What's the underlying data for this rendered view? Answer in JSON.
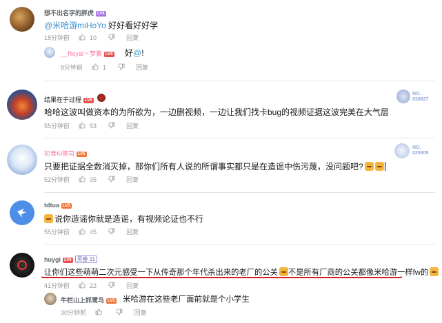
{
  "comments": [
    {
      "username": "想不出名字的胖虎",
      "level": "LV6",
      "content_mention": "@米哈游miHoYo",
      "content_text": "好好看好好学",
      "time": "18分钟前",
      "likes": "10",
      "reply_label": "回复",
      "replies": [
        {
          "username": "__Royal丶梦紫",
          "level": "LV6",
          "content_text": "好",
          "content_mention": "@",
          "content_tail": "!",
          "time": "8分钟前",
          "likes": "1",
          "reply_label": "回复"
        }
      ]
    },
    {
      "username": "结果在于过程",
      "level": "LV6",
      "content_text": "哈哈这波叫做资本的为所欲为，一边删视频，一边让我们找卡bug的视频证据这波完美在大气层",
      "time": "55分钟前",
      "likes": "53",
      "reply_label": "回复",
      "no_label": "NO.",
      "no_value": "030627"
    },
    {
      "username": "初音Ki德司",
      "level": "LV5",
      "content_text": "只要把证据全数消灭掉，那你们所有人说的所谓事实都只是在造谣中伤污蔑，没问题吧?",
      "time": "52分钟前",
      "likes": "35",
      "reply_label": "回复",
      "no_label": "NO.",
      "no_value": "025305"
    },
    {
      "username": "tdtua",
      "level": "LV5",
      "content_text": "说你造谣你就是造谣，有视频论证也不行",
      "time": "55分钟前",
      "likes": "45",
      "reply_label": "回复"
    },
    {
      "username": "huygi",
      "level": "LV6",
      "fan_badge": "灵卷",
      "fan_level": "11",
      "content_part1": "让你们这些萌萌二次元感受一下从传奇那个年代杀出来的老厂的公关",
      "content_part2": "不是所有厂商的公关都像米哈游一样fw的",
      "time": "41分钟前",
      "likes": "22",
      "reply_label": "回复",
      "replies": [
        {
          "username": "牛栏山上抓鹭鸟",
          "level": "LV5",
          "content_text": "米哈游在这些老厂面前就是个小学生",
          "time": "30分钟前",
          "reply_label": "回复"
        }
      ]
    }
  ],
  "colors": {
    "mention": "#3a91ce",
    "meta": "#9499a0",
    "annotation_underline": "#e01a1a"
  }
}
